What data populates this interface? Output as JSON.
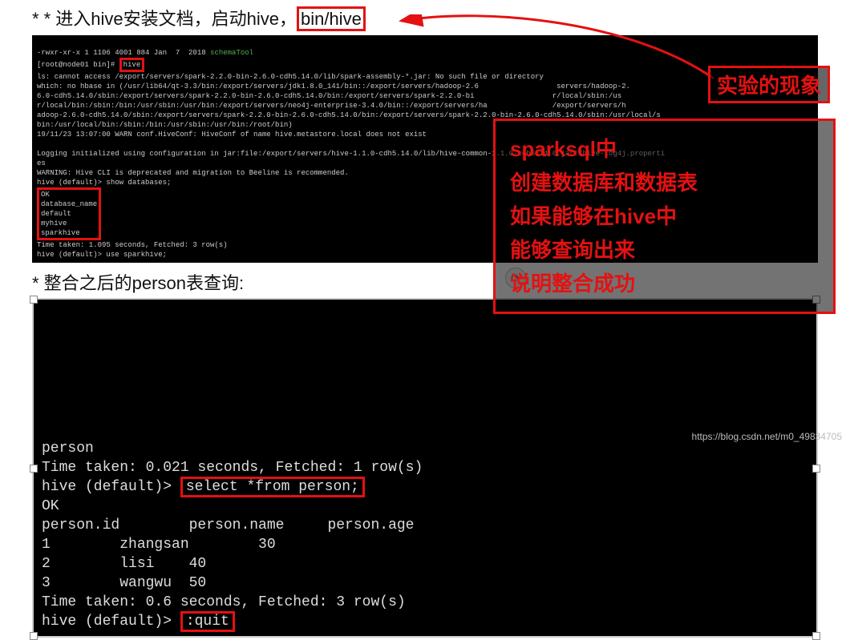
{
  "heading1": {
    "prefix": "* 进入hive安装文档，启动hive，",
    "highlight": "bin/hive"
  },
  "term1": {
    "l0": "-rwxr-xr-x 1 1106 4001 884 Jan  7  2018 ",
    "l0g": "schemaTool",
    "l1a": "[root@node01 bin]# ",
    "l1b": "hive",
    "l2": "ls: cannot access /export/servers/spark-2.2.0-bin-2.6.0-cdh5.14.0/lib/spark-assembly-*.jar: No such file or directory",
    "l3": "which: no hbase in (/usr/lib64/qt-3.3/bin:/export/servers/jdk1.8.0_141/bin::/export/servers/hadoop-2.6                  servers/hadoop-2.",
    "l4": "6.0-cdh5.14.0/sbin:/export/servers/spark-2.2.0-bin-2.6.0-cdh5.14.0/bin:/export/servers/spark-2.2.0-bi                  r/local/sbin:/us",
    "l5": "r/local/bin:/sbin:/bin:/usr/sbin:/usr/bin:/export/servers/neo4j-enterprise-3.4.0/bin::/export/servers/ha               /export/servers/h",
    "l6": "adoop-2.6.0-cdh5.14.0/sbin:/export/servers/spark-2.2.0-bin-2.6.0-cdh5.14.0/bin:/export/servers/spark-2.2.0-bin-2.6.0-cdh5.14.0/sbin:/usr/local/s",
    "l7": "bin:/usr/local/bin:/sbin:/bin:/usr/sbin:/usr/bin:/root/bin)",
    "l8": "19/11/23 13:07:00 WARN conf.HiveConf: HiveConf of name hive.metastore.local does not exist",
    "l9": "",
    "l10": "Logging initialized using configuration in jar:file:/export/servers/hive-1.1.0-cdh5.14.0/lib/hive-common-1.1.0-cdh5.14.0.jar!/hive-log4j.properti",
    "l11": "es",
    "l12": "WARNING: Hive CLI is deprecated and migration to Beeline is recommended.",
    "l13": "hive (default)> show databases;",
    "l14": "OK",
    "l15": "database_name",
    "l16": "default",
    "l17": "myhive",
    "l18": "sparkhive",
    "l19": "Time taken: 1.095 seconds, Fetched: 3 row(s)",
    "l20": "hive (default)> use sparkhive;"
  },
  "heading2": "* 整合之后的person表查询:",
  "term2": {
    "r0": "person",
    "r1": "Time taken: 0.021 seconds, Fetched: 1 row(s)",
    "r2a": "hive (default)> ",
    "r2b": "select *from person;",
    "r3": "OK",
    "r4": "person.id        person.name     person.age",
    "r5": "1        zhangsan        30",
    "r6": "2        lisi    40",
    "r7": "3        wangwu  50",
    "r8": "Time taken: 0.6 seconds, Fetched: 3 row(s)",
    "r9a": "hive (default)> ",
    "r9b": ":quit"
  },
  "annotation_label": "实验的现象",
  "annotation_lines": {
    "a1": "sparksql中",
    "a2": "创建数据库和数据表",
    "a3": "如果能够在hive中",
    "a4": "能够查询出来",
    "a5": "说明整合成功"
  },
  "watermark": "https://blog.csdn.net/m0_49834705"
}
